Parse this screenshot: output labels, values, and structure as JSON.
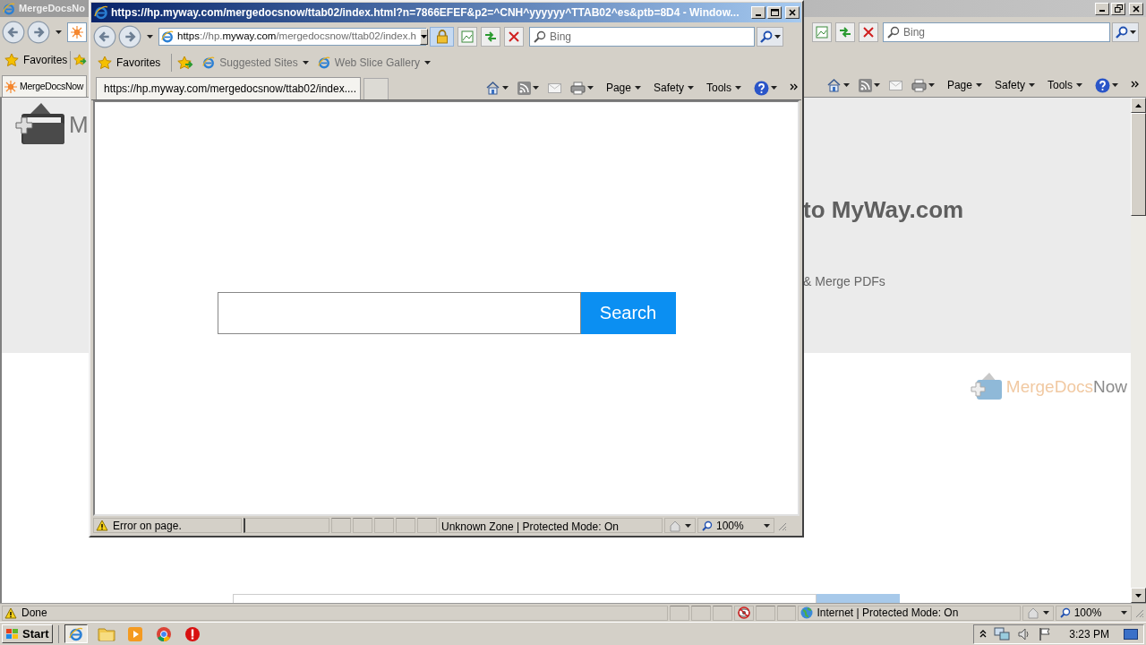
{
  "main_window": {
    "title": "MergeDocsNo",
    "search": {
      "placeholder": "Bing"
    },
    "favorites_label": "Favorites",
    "tab": {
      "title": "MergeDocsNow"
    },
    "command_menus": [
      "Page",
      "Safety",
      "Tools"
    ],
    "page": {
      "brand_initial": "M",
      "heading": "to MyWay.com",
      "subtitle": "& Merge PDFs",
      "logo": {
        "text_a": "MergeDocs",
        "text_b": "Now"
      }
    },
    "status_bar": {
      "message": "Done",
      "zone": "Internet | Protected Mode: On",
      "zoom": "100%"
    }
  },
  "popup_window": {
    "title": "https://hp.myway.com/mergedocsnow/ttab02/index.html?n=7866EFEF&p2=^CNH^yyyyyy^TTAB02^es&ptb=8D4 - Window...",
    "address": [
      {
        "text": "https",
        "dim": false
      },
      {
        "text": "://hp.",
        "dim": true
      },
      {
        "text": "myway.com",
        "dim": false
      },
      {
        "text": "/mergedocsnow/ttab02/index.h",
        "dim": true
      }
    ],
    "search": {
      "placeholder": "Bing"
    },
    "favorites_label": "Favorites",
    "favorites_links": [
      "Suggested Sites",
      "Web Slice Gallery"
    ],
    "tab": {
      "title": "https://hp.myway.com/mergedocsnow/ttab02/index...."
    },
    "command_menus": [
      "Page",
      "Safety",
      "Tools"
    ],
    "page": {
      "search_button": "Search"
    },
    "status_bar": {
      "message": "Error on page.",
      "zone": "Unknown Zone | Protected Mode: On",
      "zoom": "100%"
    }
  },
  "taskbar": {
    "start": "Start",
    "clock": "3:23 PM"
  }
}
